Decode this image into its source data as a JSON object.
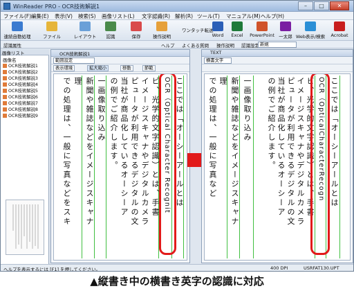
{
  "window": {
    "title": "WinReader PRO - OCR技術解説1",
    "min": "–",
    "max": "□",
    "close": "✕"
  },
  "menus": [
    "ファイル(F)",
    "編集(E)",
    "表示(V)",
    "検索(S)",
    "画像リスト(L)",
    "文字認識(R)",
    "解析(R)",
    "ツール(T)",
    "マニュアル(M)",
    "ヘルプ(H)"
  ],
  "toolbar": {
    "buttons": [
      {
        "label": "連続自動処理",
        "icon": "auto-process-icon"
      },
      {
        "label": "ファイル",
        "icon": "file-icon"
      },
      {
        "label": "レイアウト",
        "icon": "layout-icon"
      },
      {
        "label": "認識",
        "icon": "recognize-icon"
      },
      {
        "label": "保存",
        "icon": "save-icon"
      },
      {
        "label": "操作説明",
        "icon": "manual-icon"
      }
    ],
    "onetouch": "ワンタッチ転送",
    "apps": [
      {
        "label": "Word",
        "color": "#2b5fb7"
      },
      {
        "label": "Excel",
        "color": "#1f7a3a"
      },
      {
        "label": "PowerPoint",
        "color": "#d0532a"
      },
      {
        "label": "一太郎",
        "color": "#7a1fa2"
      },
      {
        "label": "Web表示/検索",
        "color": "#2b8fd6"
      },
      {
        "label": "Acrobat",
        "color": "#c81e1e"
      }
    ]
  },
  "toolbar2": {
    "recog_attr": "認識属性",
    "help": "ヘルプ",
    "faq": "よくある質問",
    "ops": "操作説明",
    "setting_label": "認識設定",
    "setting_value": "新規"
  },
  "sidebar": {
    "title": "画像リスト",
    "subtitle": "画像名",
    "items": [
      "OCR技術解説1",
      "OCR技術解説2",
      "OCR技術解説3",
      "OCR技術解説4",
      "OCR技術解説5",
      "OCR技術解説6",
      "OCR技術解説7",
      "OCR技術解説8",
      "OCR技術解説9"
    ]
  },
  "left_pane": {
    "title": "OCR技術解説1",
    "range": "範囲設定",
    "display": "表示環境",
    "zoom": "拡大縮小",
    "move": "移動",
    "select": "節範",
    "columns": [
      "ここでは「オーシーアールとは",
      "OCR（Optical Character Recognit",
      "ビ、光学的文字認識）とは、手書",
      "イメージスキャナやデジタルカメラ",
      "ピュータが利用できるデジタルの文",
      "当社が商品化しているオーシーア",
      "の例でご紹介します。",
      "一画像取り込み",
      "新聞や雑誌などをイメージスキャナ",
      "理",
      "での処理は、一般に写真などをスキ"
    ]
  },
  "right_pane": {
    "title": "TEXT",
    "mode": "横書文字",
    "columns": [
      "ここでは「オーシーアールとは",
      "OCR（OpticalCharacterRecogn",
      "ビ、光学的文字認識）とは、手書",
      "イメージスキャナやデジタルカメラ",
      "ピュータが利用できるデジタルの文",
      "当社が商品化しているオーシーア",
      "の例でご紹介します。",
      "一画像取り込み",
      "新聞や雑誌などをイメージスキャナ",
      "理",
      "での処理は、一般に写真など"
    ]
  },
  "status": {
    "message": "ヘルプを表示するには [F1] を押してください。",
    "dpi": "400 DPI",
    "file": "USRFAT130.UPT"
  },
  "caption": "▲縦書き中の横書き英字の認識に対応",
  "colors": {
    "highlight": "#e21a1a",
    "guide": "#3fbf3f",
    "arrow": "#e21a1a"
  }
}
